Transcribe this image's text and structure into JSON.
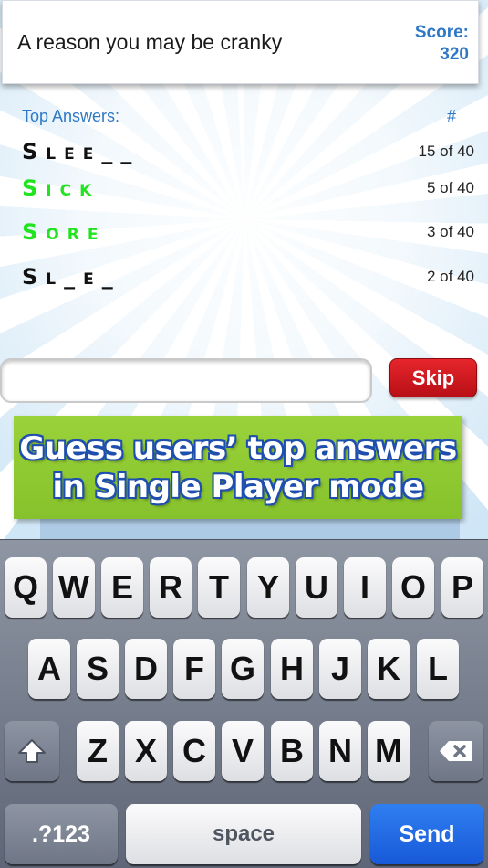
{
  "question": {
    "text": "A reason you may be cranky",
    "score_label": "Score:",
    "score_value": "320"
  },
  "answers": {
    "header": "Top Answers:",
    "count_header": "#",
    "items": [
      {
        "text": "Slee__",
        "count": "15 of 40",
        "state": "hidden"
      },
      {
        "text": "Sick",
        "count": "5 of 40",
        "state": "found"
      },
      {
        "text": "Sore",
        "count": "3 of 40",
        "state": "found"
      },
      {
        "text": "Sl_e_",
        "count": "2 of 40",
        "state": "hidden"
      }
    ]
  },
  "input": {
    "value": "",
    "placeholder": ""
  },
  "skip_label": "Skip",
  "promo": {
    "line1": "Guess users’ top answers",
    "line2": "in Single Player mode"
  },
  "keyboard": {
    "row1": [
      "Q",
      "W",
      "E",
      "R",
      "T",
      "Y",
      "U",
      "I",
      "O",
      "P"
    ],
    "row2": [
      "A",
      "S",
      "D",
      "F",
      "G",
      "H",
      "J",
      "K",
      "L"
    ],
    "row3": [
      "Z",
      "X",
      "C",
      "V",
      "B",
      "N",
      "M"
    ],
    "shift_icon": "shift-icon",
    "delete_icon": "backspace-icon",
    "numbers_label": ".?123",
    "space_label": "space",
    "send_label": "Send"
  },
  "colors": {
    "accent": "#2e78c6",
    "found": "#22e31f",
    "skip": "#d01a20",
    "send": "#1f6ae6",
    "promo_bg": "#8fca33"
  }
}
